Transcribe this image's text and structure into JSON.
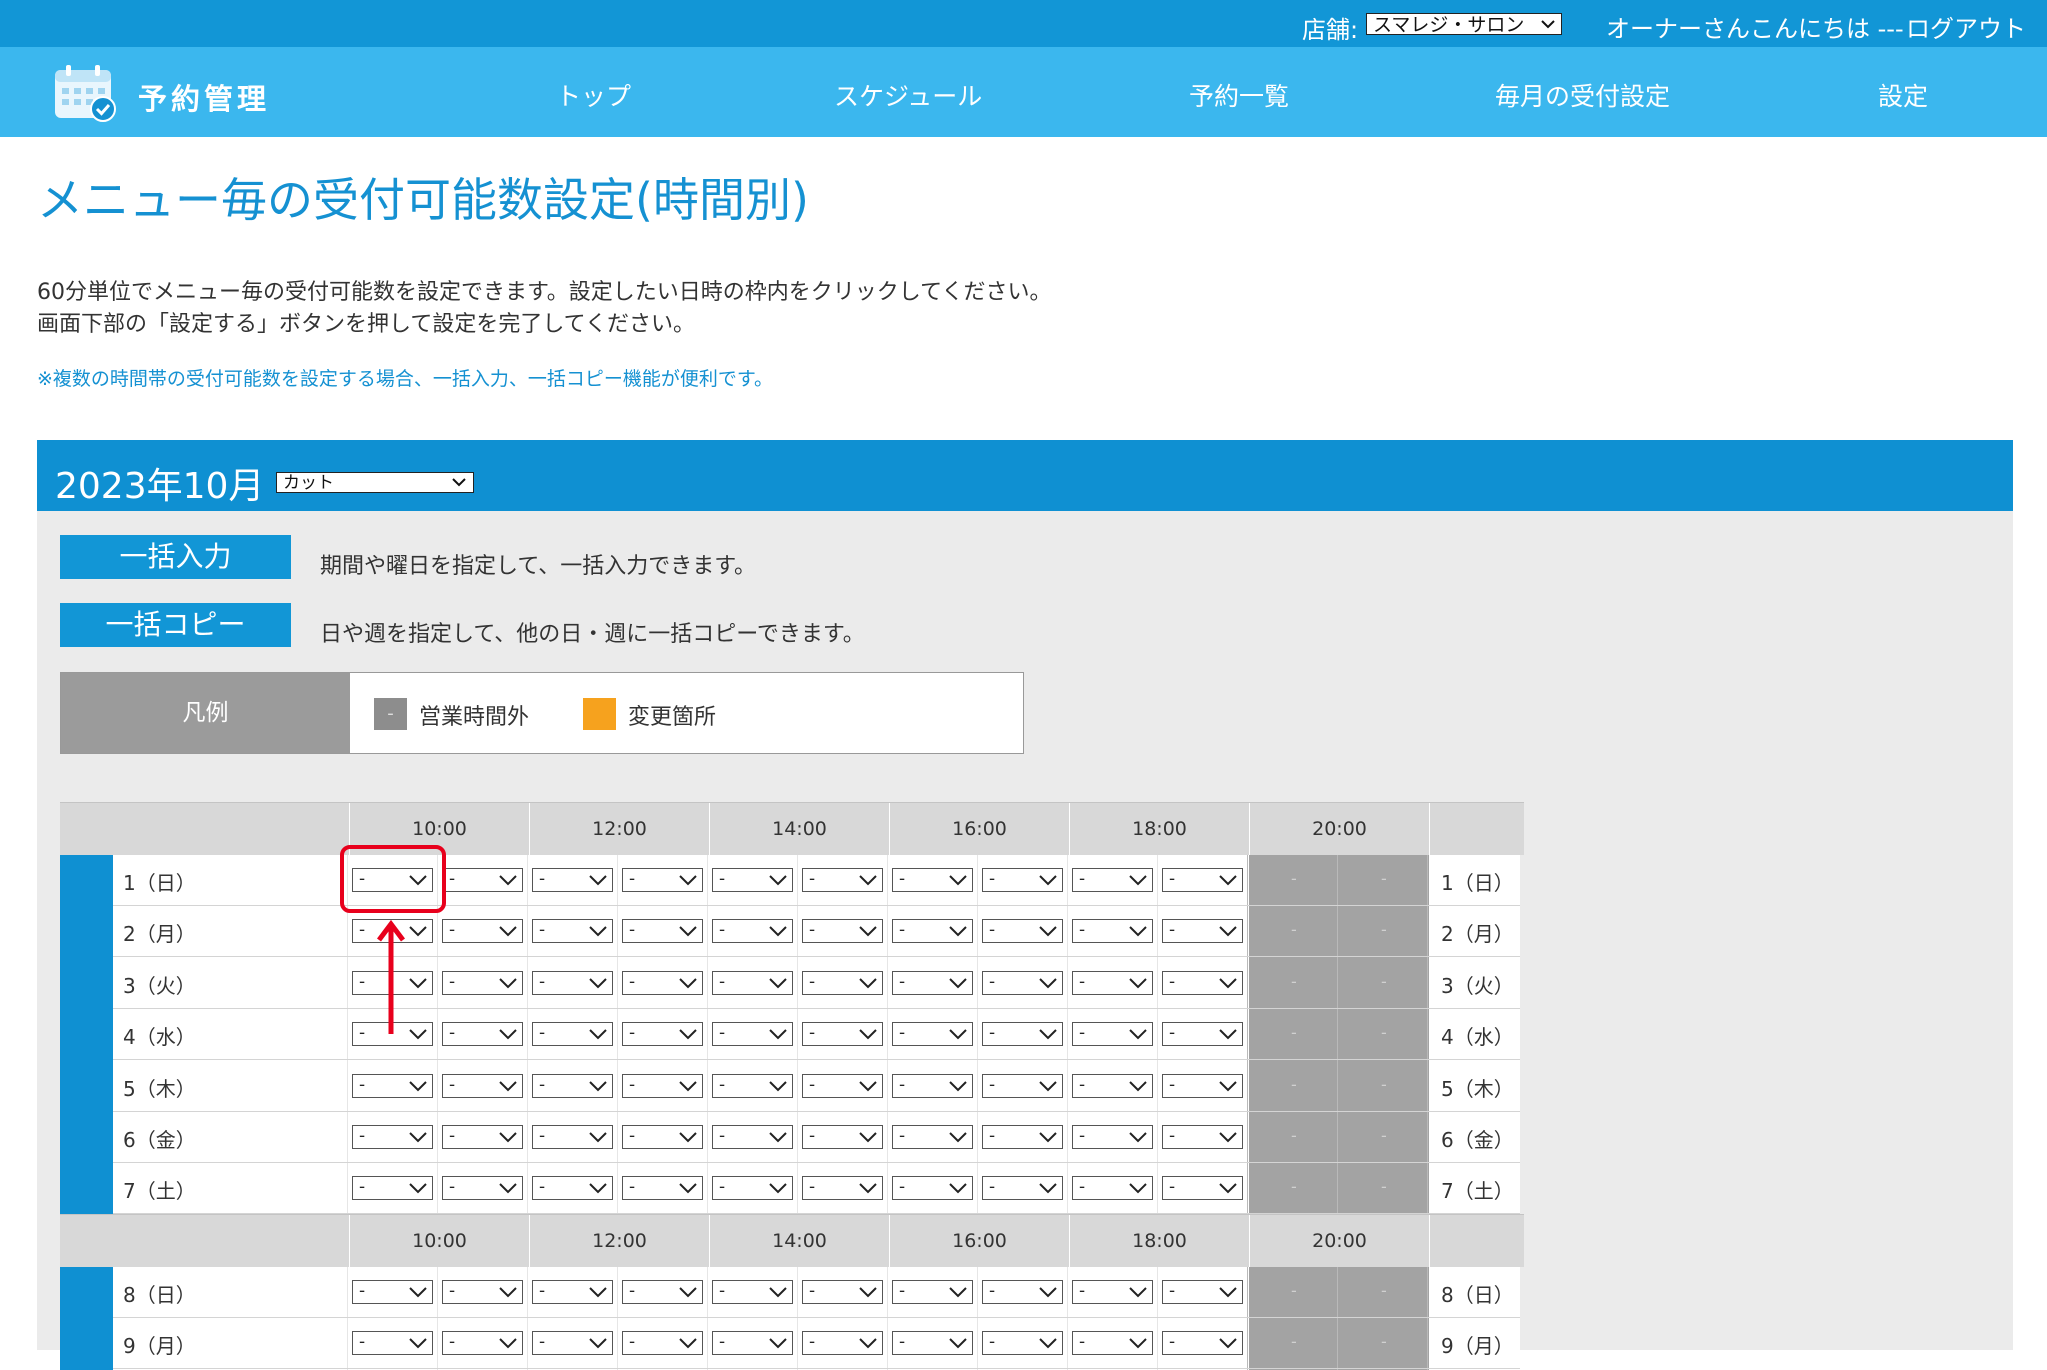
{
  "topbar": {
    "store_label": "店舗:",
    "store_selected": "スマレジ・サロン",
    "greeting": "オーナーさんこんにちは ---",
    "logout": "ログアウト"
  },
  "nav": {
    "brand": "予約管理",
    "items": [
      "トップ",
      "スケジュール",
      "予約一覧",
      "毎月の受付設定",
      "設定"
    ]
  },
  "page": {
    "title": "メニュー毎の受付可能数設定(時間別)",
    "desc_line1": "60分単位でメニュー毎の受付可能数を設定できます。設定したい日時の枠内をクリックしてください。",
    "desc_line2": "画面下部の「設定する」ボタンを押して設定を完了してください。",
    "note": "※複数の時間帯の受付可能数を設定する場合、一括入力、一括コピー機能が便利です。"
  },
  "panel": {
    "month": "2023年10月",
    "menu_selected": "カット",
    "bulk_input_label": "一括入力",
    "bulk_input_desc": "期間や曜日を指定して、一括入力できます。",
    "bulk_copy_label": "一括コピー",
    "bulk_copy_desc": "日や週を指定して、他の日・週に一括コピーできます。"
  },
  "legend": {
    "title": "凡例",
    "outside_hours_symbol": "-",
    "outside_hours_label": "営業時間外",
    "changed_label": "変更箇所"
  },
  "colors": {
    "topbar": "#1296d6",
    "navbar": "#3bb7ee",
    "title": "#1591d2",
    "changed": "#f6a21e",
    "outside_hours": "#a3a3a3",
    "highlight": "#e8001c"
  },
  "schedule": {
    "time_headers": [
      "10:00",
      "12:00",
      "14:00",
      "16:00",
      "18:00",
      "20:00"
    ],
    "select_value": "-",
    "closed_value": "-",
    "week1": [
      "1（日）",
      "2（月）",
      "3（火）",
      "4（水）",
      "5（木）",
      "6（金）",
      "7（土）"
    ],
    "week2": [
      "8（日）",
      "9（月）"
    ]
  }
}
